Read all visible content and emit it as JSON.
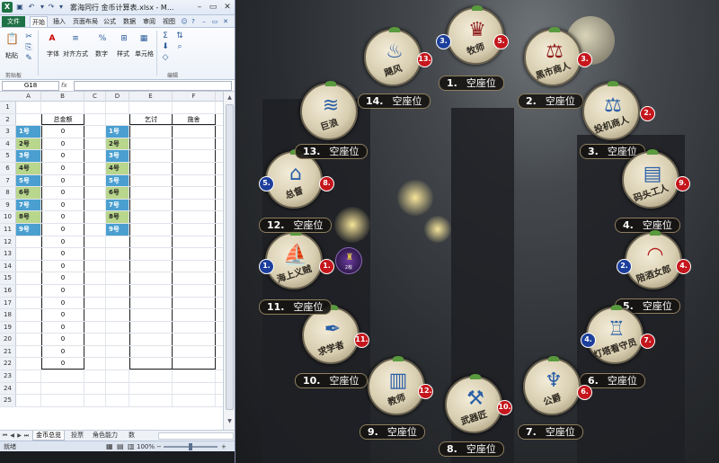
{
  "excel": {
    "title": "雾海同行 金币计算表.xlsx - M...",
    "tabs": [
      "文件",
      "开始",
      "插入",
      "页面布局",
      "公式",
      "数据",
      "审阅",
      "视图"
    ],
    "active_tab": "开始",
    "ribbon": {
      "paste": "粘贴",
      "font": "字体",
      "align": "对齐方式",
      "number": "数字",
      "styles": "样式",
      "cells": "单元格",
      "clipboard_group": "剪贴板",
      "edit_group": "编辑",
      "font_icon": "A",
      "number_icon": "%"
    },
    "namebox": "G18",
    "fx": "fx",
    "columns": [
      "A",
      "B",
      "C",
      "D",
      "E",
      "F"
    ],
    "headers": {
      "b2": "总金额",
      "e2": "乞讨",
      "f2": "施舍"
    },
    "a_labels": [
      "1号",
      "2号",
      "3号",
      "4号",
      "5号",
      "6号",
      "7号",
      "8号",
      "9号"
    ],
    "d_labels": [
      "1号",
      "2号",
      "3号",
      "4号",
      "5号",
      "6号",
      "7号",
      "8号",
      "9号"
    ],
    "row_numbers": [
      "1",
      "2",
      "3",
      "4",
      "5",
      "6",
      "7",
      "8",
      "9",
      "10",
      "11",
      "12",
      "13",
      "14",
      "15",
      "16",
      "17",
      "18",
      "19",
      "20",
      "21",
      "22",
      "23",
      "24",
      "25"
    ],
    "b_values": [
      "0",
      "0",
      "0",
      "0",
      "0",
      "0",
      "0",
      "0",
      "0",
      "0",
      "0",
      "0",
      "0",
      "0",
      "0",
      "0",
      "0",
      "0",
      "0",
      "0"
    ],
    "sheet_tabs": [
      "金币总览",
      "投票",
      "角色能力",
      "数"
    ],
    "status": {
      "ready": "就绪",
      "zoom": "100%",
      "minus": "−",
      "plus": "+"
    },
    "colors": {
      "blue_label": "#4a9fd0",
      "green_label": "#b8d68c",
      "file_tab": "#1e7145"
    }
  },
  "game": {
    "seats": [
      {
        "num": "1.",
        "status": "空座位",
        "role": "牧师",
        "badge_red": "5.",
        "badge_blue": "3.",
        "icon": "crown-icon"
      },
      {
        "num": "2.",
        "status": "空座位",
        "role": "黑市商人",
        "badge_red": "3.",
        "badge_blue": "",
        "icon": "scale-icon"
      },
      {
        "num": "3.",
        "status": "空座位",
        "role": "投机商人",
        "badge_red": "2.",
        "badge_blue": "",
        "icon": "balance-icon"
      },
      {
        "num": "4.",
        "status": "空座位",
        "role": "码头工人",
        "badge_red": "9.",
        "badge_blue": "",
        "icon": "crates-icon"
      },
      {
        "num": "5.",
        "status": "空座位",
        "role": "陪酒女郎",
        "badge_red": "4.",
        "badge_blue": "2.",
        "icon": "mask-icon"
      },
      {
        "num": "6.",
        "status": "空座位",
        "role": "灯塔看守员",
        "badge_red": "7.",
        "badge_blue": "4.",
        "icon": "lighthouse-icon"
      },
      {
        "num": "7.",
        "status": "空座位",
        "role": "公爵",
        "badge_red": "6.",
        "badge_blue": "",
        "icon": "goblet-icon"
      },
      {
        "num": "8.",
        "status": "空座位",
        "role": "武器匠",
        "badge_red": "10.",
        "badge_blue": "",
        "icon": "anvil-icon"
      },
      {
        "num": "9.",
        "status": "空座位",
        "role": "教师",
        "badge_red": "12.",
        "badge_blue": "",
        "icon": "book-icon"
      },
      {
        "num": "10.",
        "status": "空座位",
        "role": "求学者",
        "badge_red": "11.",
        "badge_blue": "",
        "icon": "quill-icon"
      },
      {
        "num": "11.",
        "status": "空座位",
        "role": "海上义贼",
        "badge_red": "1.",
        "badge_blue": "1.",
        "icon": "ship-icon"
      },
      {
        "num": "12.",
        "status": "空座位",
        "role": "总督",
        "badge_red": "8.",
        "badge_blue": "5.",
        "icon": "hat-icon"
      },
      {
        "num": "13.",
        "status": "空座位",
        "role": "巨浪",
        "badge_red": "",
        "badge_blue": "",
        "icon": "wave-icon"
      },
      {
        "num": "14.",
        "status": "空座位",
        "role": "飓风",
        "badge_red": "13.",
        "badge_blue": "",
        "icon": "tornado-icon"
      }
    ],
    "token": {
      "text": "2枚",
      "icon": "trophy-icon"
    },
    "colors": {
      "red_badge": "#c4161c",
      "blue_badge": "#1d3f9c",
      "plate_bg": "#161412"
    }
  }
}
